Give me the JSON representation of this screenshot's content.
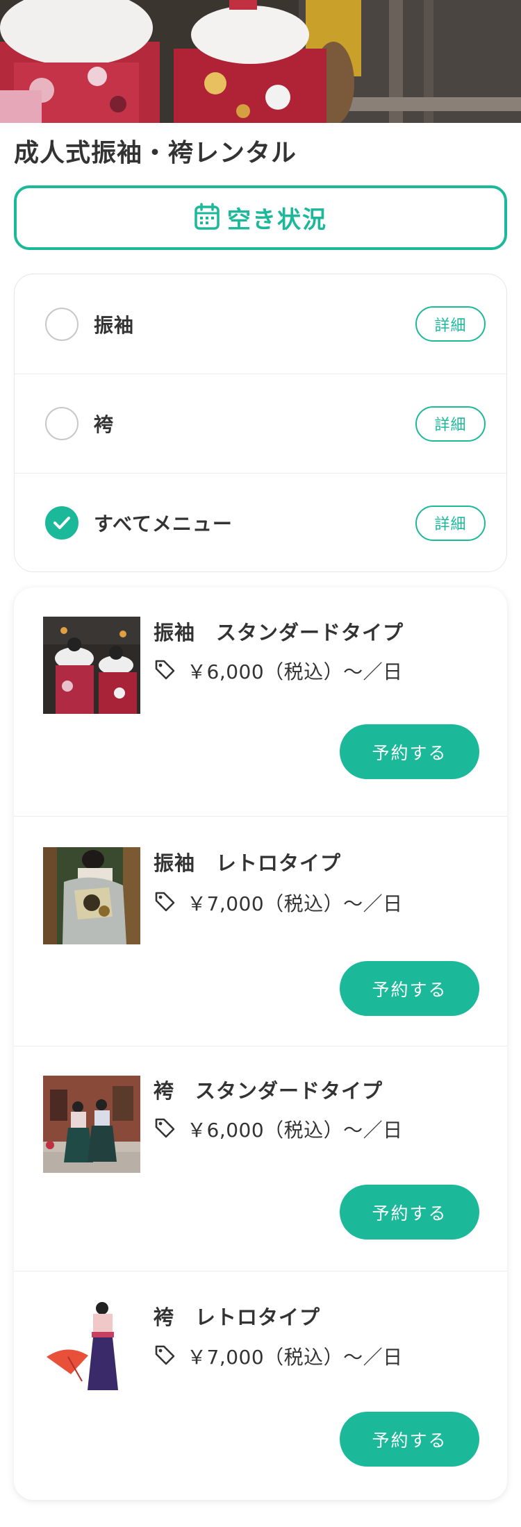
{
  "page": {
    "title": "成人式振袖・袴レンタル"
  },
  "availability_button": {
    "label": "空き状況",
    "icon": "calendar-icon"
  },
  "filters": [
    {
      "label": "振袖",
      "checked": false,
      "detail_label": "詳細"
    },
    {
      "label": "袴",
      "checked": false,
      "detail_label": "詳細"
    },
    {
      "label": "すべてメニュー",
      "checked": true,
      "detail_label": "詳細"
    }
  ],
  "products": [
    {
      "name": "振袖　スタンダードタイプ",
      "price": "￥6,000（税込）〜／日",
      "reserve_label": "予約する",
      "image": "furisode-standard-photo"
    },
    {
      "name": "振袖　レトロタイプ",
      "price": "￥7,000（税込）〜／日",
      "reserve_label": "予約する",
      "image": "furisode-retro-photo"
    },
    {
      "name": "袴　スタンダードタイプ",
      "price": "￥6,000（税込）〜／日",
      "reserve_label": "予約する",
      "image": "hakama-standard-photo"
    },
    {
      "name": "袴　レトロタイプ",
      "price": "￥7,000（税込）〜／日",
      "reserve_label": "予約する",
      "image": "hakama-retro-photo"
    }
  ],
  "colors": {
    "accent": "#1bb89a",
    "text": "#333333",
    "border": "#e6e6e6"
  }
}
